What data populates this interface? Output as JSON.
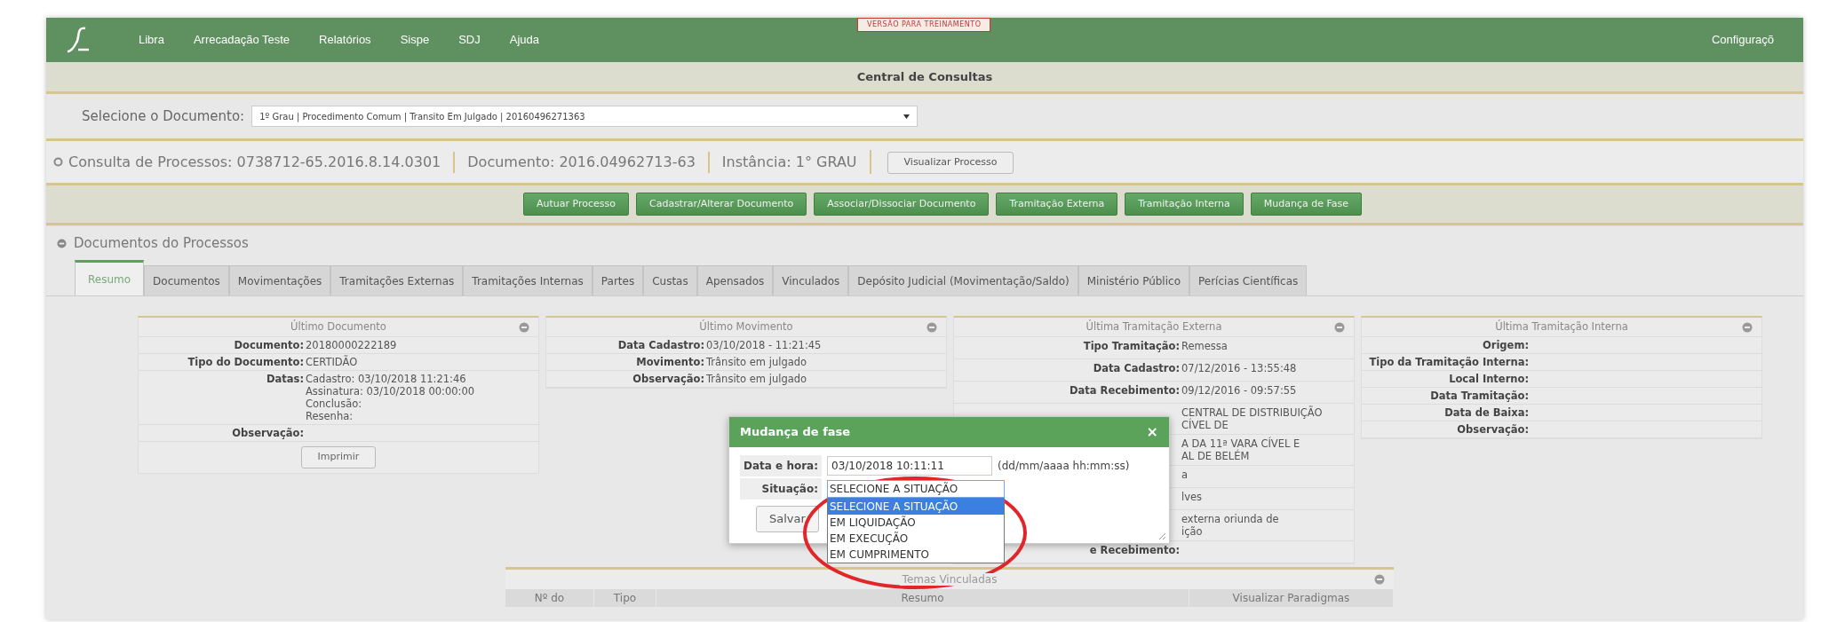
{
  "nav": {
    "items": [
      "Libra",
      "Arrecadação Teste",
      "Relatórios",
      "Sispe",
      "SDJ",
      "Ajuda"
    ],
    "notice": "VERSÃO PARA TREINAMENTO",
    "right_item": "Configuraçõ"
  },
  "page_title": "Central de Consultas",
  "document_select": {
    "label": "Selecione o Documento:",
    "value": "1º Grau | Procedimento Comum | Transito Em Julgado | 20160496271363"
  },
  "process_info": {
    "parts": [
      {
        "label": "Consulta de Processos:",
        "value": "0738712-65.2016.8.14.0301"
      },
      {
        "label": "Documento:",
        "value": "2016.04962713-63"
      },
      {
        "label": "Instância:",
        "value": "1° GRAU"
      }
    ],
    "button": "Visualizar Processo"
  },
  "actions": [
    "Autuar Processo",
    "Cadastrar/Alterar Documento",
    "Associar/Dissociar Documento",
    "Tramitação Externa",
    "Tramitação Interna",
    "Mudança de Fase"
  ],
  "section_title": "Documentos do Processos",
  "tabs": [
    {
      "label": "Resumo",
      "selected": true
    },
    {
      "label": "Documentos",
      "selected": false
    },
    {
      "label": "Movimentações",
      "selected": false
    },
    {
      "label": "Tramitações Externas",
      "selected": false
    },
    {
      "label": "Tramitações Internas",
      "selected": false
    },
    {
      "label": "Partes",
      "selected": false
    },
    {
      "label": "Custas",
      "selected": false
    },
    {
      "label": "Apensados",
      "selected": false
    },
    {
      "label": "Vinculados",
      "selected": false
    },
    {
      "label": "Depósito Judicial (Movimentação/Saldo)",
      "selected": false
    },
    {
      "label": "Ministério Público",
      "selected": false
    },
    {
      "label": "Perícias Científicas",
      "selected": false
    }
  ],
  "cards": [
    {
      "title": "Último Documento",
      "rows": [
        {
          "label": "Documento:",
          "value": "20180000222189"
        },
        {
          "label": "Tipo do Documento:",
          "value": "CERTIDÃO"
        },
        {
          "label": "Datas:",
          "lines": [
            "Cadastro: 03/10/2018 11:21:46",
            "Assinatura: 03/10/2018 00:00:00",
            "Conclusão:",
            "Resenha:"
          ]
        },
        {
          "label": "Observação:"
        }
      ],
      "button": "Imprimir"
    },
    {
      "title": "Último Movimento",
      "rows": [
        {
          "label": "Data Cadastro:",
          "value": "03/10/2018 - 11:21:45"
        },
        {
          "label": "Movimento:",
          "value": "Trânsito em julgado"
        },
        {
          "label": "Observação:",
          "value": "Trânsito em julgado"
        }
      ]
    },
    {
      "title": "Última Tramitação Externa",
      "rows": [
        {
          "label": "Tipo Tramitação:",
          "value": "Remessa"
        },
        {
          "label": "Data Cadastro:",
          "value": "07/12/2016 - 13:55:48"
        },
        {
          "label": "Data Recebimento:",
          "value": "09/12/2016 - 09:57:55"
        },
        {
          "lines": [
            "CENTRAL DE DISTRIBUIÇÃO CÍVEL DE"
          ]
        },
        {
          "lines": [
            "A DA 11ª VARA CÍVEL E",
            "AL DE BELÉM"
          ]
        },
        {
          "value": "a"
        },
        {
          "value": "lves"
        },
        {
          "lines": [
            "externa oriunda de",
            "ição"
          ]
        },
        {
          "label": "e Recebimento:"
        }
      ]
    },
    {
      "title": "Última Tramitação Interna",
      "rows": [
        {
          "label": "Origem:"
        },
        {
          "label": "Tipo da Tramitação Interna:"
        },
        {
          "label": "Local Interno:"
        },
        {
          "label": "Data Tramitação:"
        },
        {
          "label": "Data de Baixa:"
        },
        {
          "label": "Observação:"
        }
      ]
    }
  ],
  "linked_themes": {
    "title": "Temas Vinculadas",
    "columns": [
      "Nº do",
      "Tipo",
      "Resumo",
      "Visualizar Paradigmas"
    ]
  },
  "modal": {
    "title": "Mudança de fase",
    "close": "×",
    "fields": [
      {
        "kind": "input",
        "label": "Data e hora:",
        "value": "03/10/2018 10:11:11",
        "hint": "(dd/mm/aaaa hh:mm:ss)"
      },
      {
        "kind": "select",
        "label": "Situação:",
        "value": "SELECIONE A SITUAÇÃO",
        "expanded": true,
        "options": [
          {
            "label": "SELECIONE A SITUAÇÃO",
            "selected": true
          },
          {
            "label": "EM LIQUIDAÇÃO",
            "selected": false
          },
          {
            "label": "EM EXECUÇÃO",
            "selected": false
          },
          {
            "label": "EM CUMPRIMENTO",
            "selected": false
          }
        ]
      }
    ],
    "submit": "Salvar"
  }
}
